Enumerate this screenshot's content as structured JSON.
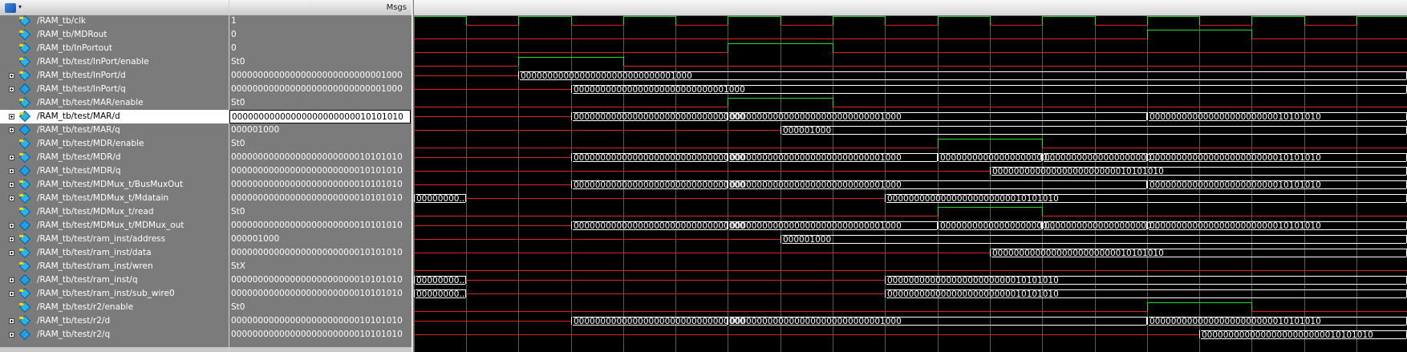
{
  "toolbar": {
    "icon": "wave-window-icon",
    "menu_arrow": "▾"
  },
  "header": {
    "values_label": "Msgs"
  },
  "colors": {
    "high": "#19e019",
    "low": "#e02020",
    "bus": "#ffffff",
    "cursor": "#f4f4f4"
  },
  "selected_index": 7,
  "signals": [
    {
      "name": "/RAM_tb/clk",
      "value": "1",
      "dir": "in",
      "bus": false
    },
    {
      "name": "/RAM_tb/MDRout",
      "value": "0",
      "dir": "in",
      "bus": false
    },
    {
      "name": "/RAM_tb/InPortout",
      "value": "0",
      "dir": "in",
      "bus": false
    },
    {
      "name": "/RAM_tb/test/InPort/enable",
      "value": "St0",
      "dir": "in",
      "bus": false
    },
    {
      "name": "/RAM_tb/test/InPort/d",
      "value": "00000000000000000000000000001000",
      "dir": "in",
      "bus": true
    },
    {
      "name": "/RAM_tb/test/InPort/q",
      "value": "00000000000000000000000000001000",
      "dir": "out",
      "bus": true
    },
    {
      "name": "/RAM_tb/test/MAR/enable",
      "value": "St0",
      "dir": "in",
      "bus": false
    },
    {
      "name": "/RAM_tb/test/MAR/d",
      "value": "00000000000000000000000010101010",
      "dir": "in",
      "bus": true
    },
    {
      "name": "/RAM_tb/test/MAR/q",
      "value": "000001000",
      "dir": "out",
      "bus": true
    },
    {
      "name": "/RAM_tb/test/MDR/enable",
      "value": "St0",
      "dir": "in",
      "bus": false
    },
    {
      "name": "/RAM_tb/test/MDR/d",
      "value": "00000000000000000000000010101010",
      "dir": "in",
      "bus": true
    },
    {
      "name": "/RAM_tb/test/MDR/q",
      "value": "00000000000000000000000010101010",
      "dir": "out",
      "bus": true
    },
    {
      "name": "/RAM_tb/test/MDMux_t/BusMuxOut",
      "value": "00000000000000000000000010101010",
      "dir": "in",
      "bus": true
    },
    {
      "name": "/RAM_tb/test/MDMux_t/Mdatain",
      "value": "00000000000000000000000010101010",
      "dir": "in",
      "bus": true
    },
    {
      "name": "/RAM_tb/test/MDMux_t/read",
      "value": "St0",
      "dir": "in",
      "bus": false
    },
    {
      "name": "/RAM_tb/test/MDMux_t/MDMux_out",
      "value": "00000000000000000000000010101010",
      "dir": "out",
      "bus": true
    },
    {
      "name": "/RAM_tb/test/ram_inst/address",
      "value": "000001000",
      "dir": "in",
      "bus": true
    },
    {
      "name": "/RAM_tb/test/ram_inst/data",
      "value": "00000000000000000000000010101010",
      "dir": "in",
      "bus": true
    },
    {
      "name": "/RAM_tb/test/ram_inst/wren",
      "value": "StX",
      "dir": "in",
      "bus": false
    },
    {
      "name": "/RAM_tb/test/ram_inst/q",
      "value": "00000000000000000000000010101010",
      "dir": "out",
      "bus": true
    },
    {
      "name": "/RAM_tb/test/ram_inst/sub_wire0",
      "value": "00000000000000000000000010101010",
      "dir": "in",
      "bus": true
    },
    {
      "name": "/RAM_tb/test/r2/enable",
      "value": "St0",
      "dir": "in",
      "bus": false
    },
    {
      "name": "/RAM_tb/test/r2/d",
      "value": "00000000000000000000000010101010",
      "dir": "in",
      "bus": true
    },
    {
      "name": "/RAM_tb/test/r2/q",
      "value": "00000000000000000000000010101010",
      "dir": "out",
      "bus": true
    }
  ],
  "waves": {
    "clock_edges": [
      0,
      65,
      130,
      196,
      261,
      326,
      391,
      457,
      522,
      587,
      653,
      718,
      783,
      849,
      914,
      979,
      1044,
      1110,
      1175,
      1238
    ],
    "bits": [
      {
        "type": "clock"
      },
      {
        "segments": [
          [
            0,
            914,
            "L"
          ],
          [
            914,
            1044,
            "H"
          ],
          [
            1044,
            1238,
            "L"
          ]
        ]
      },
      {
        "segments": [
          [
            0,
            391,
            "L"
          ],
          [
            391,
            522,
            "H"
          ],
          [
            522,
            1238,
            "L"
          ]
        ]
      },
      {
        "segments": [
          [
            0,
            130,
            "L"
          ],
          [
            130,
            261,
            "H"
          ],
          [
            261,
            1238,
            "L"
          ]
        ]
      },
      null,
      null,
      {
        "segments": [
          [
            0,
            391,
            "L"
          ],
          [
            391,
            522,
            "H"
          ],
          [
            522,
            1238,
            "L"
          ]
        ]
      },
      null,
      null,
      {
        "segments": [
          [
            0,
            653,
            "L"
          ],
          [
            653,
            783,
            "H"
          ],
          [
            783,
            1238,
            "L"
          ]
        ]
      },
      null,
      null,
      null,
      null,
      {
        "segments": [
          [
            0,
            653,
            "L"
          ],
          [
            653,
            783,
            "H"
          ],
          [
            783,
            1238,
            "L"
          ]
        ]
      },
      null,
      null,
      null,
      {
        "segments": [
          [
            0,
            1238,
            "L"
          ]
        ]
      },
      null,
      null,
      {
        "segments": [
          [
            0,
            914,
            "L"
          ],
          [
            914,
            1044,
            "H"
          ],
          [
            1044,
            1238,
            "L"
          ]
        ]
      },
      null,
      null
    ],
    "buses": [
      null,
      null,
      null,
      null,
      [
        [
          0,
          130,
          "L",
          ""
        ],
        [
          130,
          1238,
          "V",
          "00000000000000000000000000001000"
        ]
      ],
      [
        [
          0,
          196,
          "L",
          ""
        ],
        [
          196,
          1238,
          "V",
          "00000000000000000000000000001000"
        ]
      ],
      null,
      [
        [
          0,
          196,
          "L",
          ""
        ],
        [
          196,
          391,
          "V",
          "00000000000000000000000000000000"
        ],
        [
          391,
          914,
          "V",
          "00000000000000000000000000001000"
        ],
        [
          914,
          1238,
          "V",
          "00000000000000000000000010101010"
        ]
      ],
      [
        [
          0,
          457,
          "L",
          ""
        ],
        [
          457,
          1238,
          "V",
          "000001000"
        ]
      ],
      null,
      [
        [
          0,
          196,
          "L",
          ""
        ],
        [
          196,
          391,
          "V",
          "00000000000000000000000000000000"
        ],
        [
          391,
          653,
          "V",
          "00000000000000000000000000001000"
        ],
        [
          653,
          783,
          "V",
          "00000000000000000000..."
        ],
        [
          783,
          914,
          "V",
          "00000000000000000000..."
        ],
        [
          914,
          1238,
          "V",
          "00000000000000000000000010101010"
        ]
      ],
      [
        [
          0,
          718,
          "L",
          ""
        ],
        [
          718,
          1238,
          "V",
          "00000000000000000000000010101010"
        ]
      ],
      [
        [
          0,
          196,
          "L",
          ""
        ],
        [
          196,
          391,
          "V",
          "00000000000000000000000000000000"
        ],
        [
          391,
          914,
          "V",
          "00000000000000000000000000001000"
        ],
        [
          914,
          1238,
          "V",
          "00000000000000000000000010101010"
        ]
      ],
      [
        [
          0,
          65,
          "V",
          "00000000..."
        ],
        [
          65,
          587,
          "L",
          ""
        ],
        [
          587,
          1238,
          "V",
          "00000000000000000000000010101010"
        ]
      ],
      null,
      [
        [
          0,
          196,
          "L",
          ""
        ],
        [
          196,
          391,
          "V",
          "00000000000000000000000000000000"
        ],
        [
          391,
          653,
          "V",
          "00000000000000000000000000001000"
        ],
        [
          653,
          783,
          "V",
          "00000000000000000000..."
        ],
        [
          783,
          914,
          "V",
          "00000000000000000000..."
        ],
        [
          914,
          1238,
          "V",
          "00000000000000000000000010101010"
        ]
      ],
      [
        [
          0,
          457,
          "L",
          ""
        ],
        [
          457,
          1238,
          "V",
          "000001000"
        ]
      ],
      [
        [
          0,
          718,
          "L",
          ""
        ],
        [
          718,
          1238,
          "V",
          "00000000000000000000000010101010"
        ]
      ],
      null,
      [
        [
          0,
          65,
          "V",
          "00000000..."
        ],
        [
          65,
          587,
          "L",
          ""
        ],
        [
          587,
          1238,
          "V",
          "00000000000000000000000010101010"
        ]
      ],
      [
        [
          0,
          65,
          "V",
          "00000000..."
        ],
        [
          65,
          587,
          "L",
          ""
        ],
        [
          587,
          1238,
          "V",
          "00000000000000000000000010101010"
        ]
      ],
      null,
      [
        [
          0,
          196,
          "L",
          ""
        ],
        [
          196,
          391,
          "V",
          "00000000000000000000000000000000"
        ],
        [
          391,
          914,
          "V",
          "00000000000000000000000000001000"
        ],
        [
          914,
          1238,
          "V",
          "00000000000000000000000010101010"
        ]
      ],
      [
        [
          0,
          979,
          "L",
          ""
        ],
        [
          979,
          1238,
          "V",
          "00000000000000000000000010101010"
        ]
      ]
    ]
  }
}
